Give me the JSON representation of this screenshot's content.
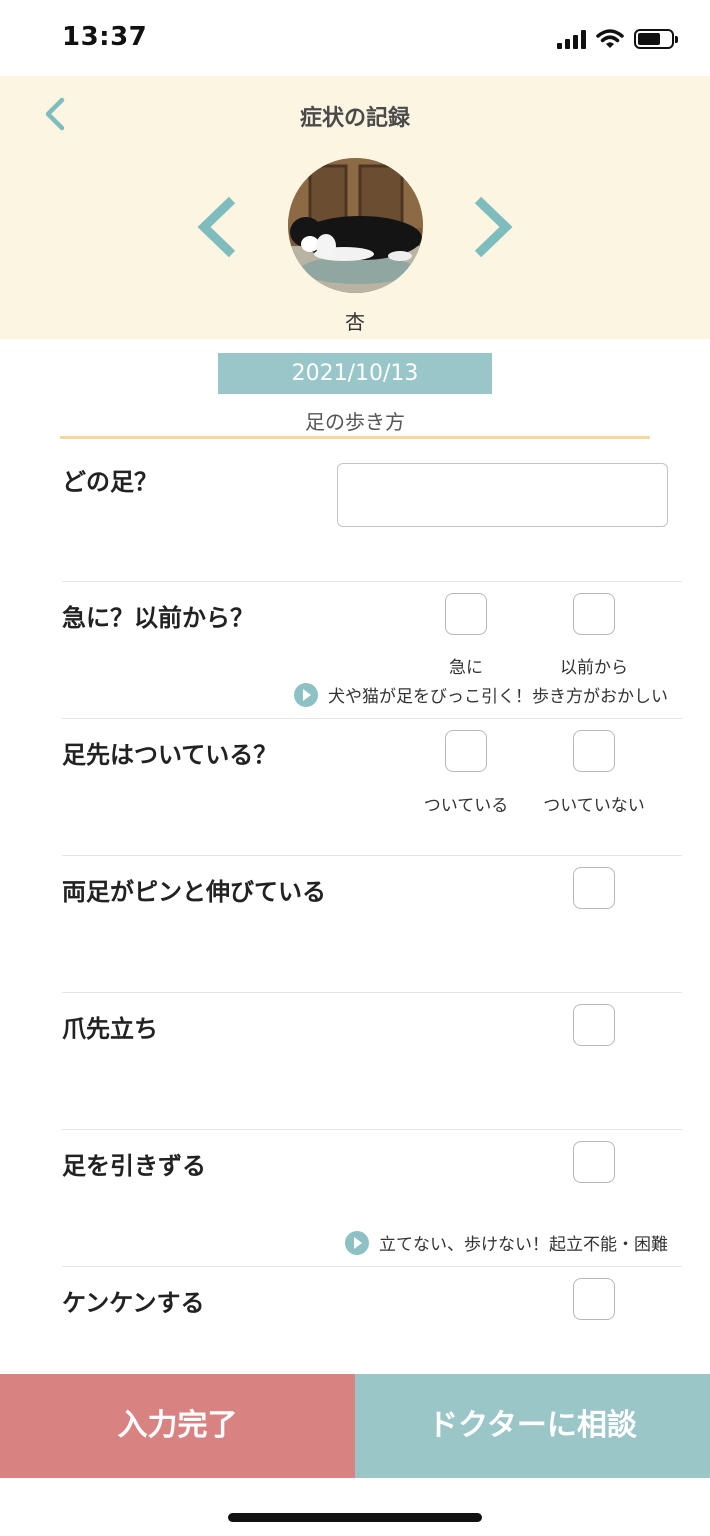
{
  "status_bar": {
    "time": "13:37"
  },
  "header": {
    "title": "症状の記録",
    "pet_name": "杏",
    "accent_color": "#7fbcbe",
    "background_color": "#fcf5e2"
  },
  "record": {
    "date": "2021/10/13",
    "category": "足の歩き方"
  },
  "questions": {
    "which_leg": {
      "label": "どの足？",
      "value": "",
      "placeholder": ""
    },
    "onset": {
      "label": "急に？以前から？",
      "options": [
        "急に",
        "以前から"
      ],
      "note": "犬や猫が足をびっこ引く！歩き方がおかしい"
    },
    "toes": {
      "label": "足先はついている？",
      "options": [
        "ついている",
        "ついていない"
      ]
    },
    "legs_stretched": {
      "label": "両足がピンと伸びている"
    },
    "tiptoe": {
      "label": "爪先立ち"
    },
    "dragging": {
      "label": "足を引きずる",
      "note": "立てない、歩けない！起立不能・困難"
    },
    "hopping": {
      "label": "ケンケンする"
    }
  },
  "footer": {
    "complete_label": "入力完了",
    "doctor_label": "ドクターに相談",
    "complete_color": "#d88282",
    "doctor_color": "#9bc6c8"
  }
}
